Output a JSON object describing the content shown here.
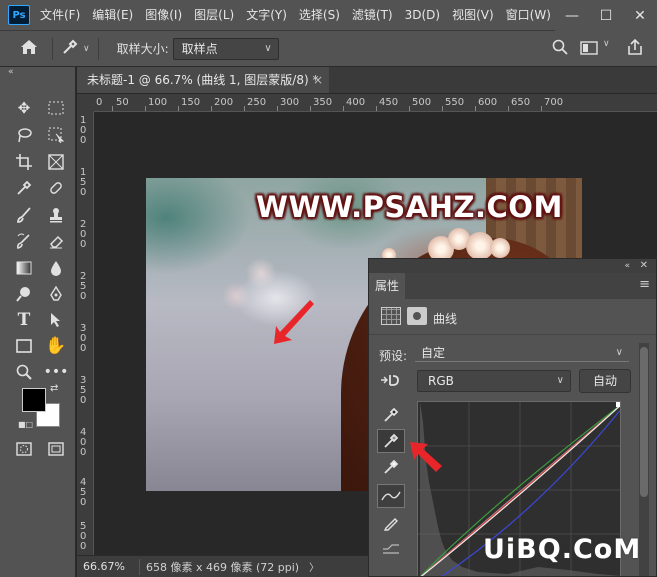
{
  "app": {
    "logo": "Ps",
    "menus": [
      "文件(F)",
      "编辑(E)",
      "图像(I)",
      "图层(L)",
      "文字(Y)",
      "选择(S)",
      "滤镜(T)",
      "3D(D)",
      "视图(V)",
      "窗口(W)",
      "帮"
    ],
    "window_controls": {
      "minimize": "—",
      "maximize": "☐",
      "close": "✕"
    }
  },
  "options_bar": {
    "sample_size_label": "取样大小:",
    "sample_size_value": "取样点"
  },
  "document": {
    "tab_title": "未标题-1 @ 66.7% (曲线 1, 图层蒙版/8) *",
    "tab_close": "×"
  },
  "rulers": {
    "top_labels": [
      "0",
      "50",
      "100",
      "150",
      "200",
      "250",
      "300",
      "350",
      "400",
      "450",
      "500",
      "550",
      "600",
      "650",
      "700"
    ],
    "left_labels": [
      "1 0 0",
      "1 5 0",
      "2 0 0",
      "2 5 0",
      "3 0 0",
      "3 5 0",
      "4 0 0",
      "4 5 0",
      "5 0 0"
    ]
  },
  "canvas": {
    "watermark_text": "WWW.PSAHZ.COM"
  },
  "status_bar": {
    "zoom": "66.67%",
    "doc_info": "658 像素 x 469 像素 (72 ppi)",
    "arrow": "〉"
  },
  "properties_panel": {
    "tab_label": "属性",
    "adjustment_name": "曲线",
    "preset_label": "预设:",
    "preset_value": "自定",
    "channel_value": "RGB",
    "auto_label": "自动"
  },
  "watermark_bottom": "UiBQ.CoM",
  "colors": {
    "arrow_red": "#e8262a",
    "panel_bg": "#535353",
    "canvas_bg": "#282828"
  }
}
